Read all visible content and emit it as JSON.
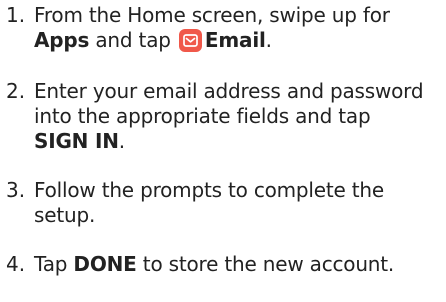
{
  "steps": [
    {
      "number": "1.",
      "intro": "From the Home screen, swipe up for",
      "apps_label": "Apps",
      "and_tap": " and tap ",
      "email_label": "Email",
      "end": "."
    },
    {
      "number": "2.",
      "text": "Enter your email address and password into the appropriate fields and tap",
      "action_label": "SIGN IN",
      "end": "."
    },
    {
      "number": "3.",
      "text": "Follow the prompts to complete the setup."
    },
    {
      "number": "4.",
      "tap": "Tap ",
      "action_label": "DONE",
      "text": " to store the new account."
    }
  ],
  "icons": {
    "email_app": "email-app-icon",
    "email_icon_color": "#f0584a"
  }
}
